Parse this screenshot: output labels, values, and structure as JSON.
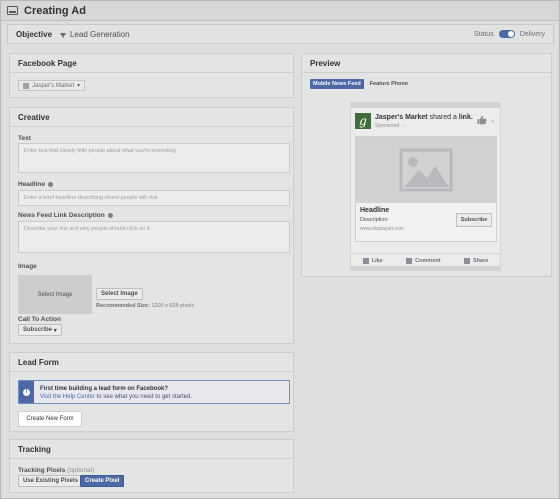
{
  "window": {
    "title": "Creating Ad"
  },
  "objective": {
    "label": "Objective",
    "value": "Lead Generation",
    "status_label": "Status",
    "delivery_label": "Delivery"
  },
  "facebook_page": {
    "heading": "Facebook Page",
    "selected": "Jasper's Market"
  },
  "creative": {
    "heading": "Creative",
    "text_label": "Text",
    "text_placeholder": "Enter text that clearly tells people about what you're promoting",
    "headline_label": "Headline",
    "headline_placeholder": "Enter a brief headline describing where people will visit",
    "link_desc_label": "News Feed Link Description",
    "link_desc_placeholder": "Describe your link and why people should click on it",
    "image_label": "Image",
    "image_box": "Select Image",
    "select_image_button": "Select Image",
    "recommended_label": "Recommended Size:",
    "recommended_value": "1200 x 628 pixels",
    "cta_label": "Call To Action",
    "cta_value": "Subscribe"
  },
  "lead_form": {
    "heading": "Lead Form",
    "notice_title": "First time building a lead form on Facebook?",
    "notice_link": "Visit the Help Center",
    "notice_rest": "to see what you need to get started.",
    "create_button": "Create New Form"
  },
  "tracking": {
    "heading": "Tracking",
    "pixels_label": "Tracking Pixels",
    "optional": "(optional)",
    "use_existing": "Use Existing Pixels",
    "create_pixel": "Create Pixel"
  },
  "preview": {
    "heading": "Preview",
    "tabs": [
      "Mobile News Feed",
      "Feature Phone"
    ],
    "page_name": "Jasper's Market",
    "shared_text": "shared a",
    "shared_link": "link.",
    "sponsored": "Sponsored",
    "headline": "Headline",
    "description": "Description",
    "url": "www.displayurl.com",
    "subscribe": "Subscribe",
    "like": "Like",
    "comment": "Comment",
    "share": "Share"
  },
  "colors": {
    "accent": "#4a69a6",
    "logo_green": "#3f6e3a"
  }
}
